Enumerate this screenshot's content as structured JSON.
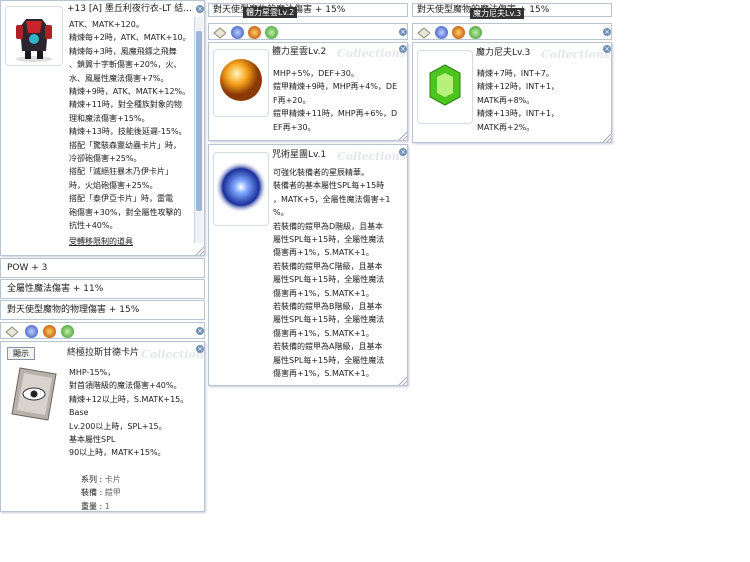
{
  "w1": {
    "title": "+13 [A] 墨丘利夜行衣-LT 結...",
    "watermark": "Collections",
    "lines": [
      "ATK、MATK+120。",
      "精煉每+2時，ATK、MATK+10。",
      "精煉每+3時，風魔飛鏢之飛舞",
      "、鎖翼十字斬傷害+20%，火、",
      "水、風屬性魔法傷害+7%。",
      "精煉+9時，ATK、MATK+12%。",
      "精煉+11時，對全種族對象的物",
      "理和魔法傷害+15%。",
      "精煉+13時，技能後延遲-15%。",
      "搭配「驚駭森靈幼蟲卡片」時，",
      "冷卻砲傷害+25%。",
      "搭配「滅絕狂暴木乃伊卡片」",
      "時，火焰砲傷害+25%。",
      "搭配「泰伊亞卡片」時，雷電",
      "砲傷害+30%，對全屬性攻擊的",
      "抗性+40%。"
    ],
    "link": "受轉移限制的道具"
  },
  "bars": {
    "pow": "POW + 3",
    "magic": "全屬性魔法傷害 + 11%",
    "phys": "對天使型魔物的物理傷害 + 15%"
  },
  "w2": {
    "title": "終極拉斯甘德卡片",
    "btn": "顯示",
    "watermark": "Collections",
    "lines": [
      "MHP-15%，",
      "對首領階級的魔法傷害+40%。",
      "精煉+12以上時，S.MATK+15。",
      "Base",
      "Lv.200以上時，SPL+15。",
      "基本屬性SPL",
      "90以上時，MATK+15%。"
    ],
    "attrs": [
      {
        "k": "系列",
        "v": "卡片"
      },
      {
        "k": "裝備",
        "v": "鎧甲"
      },
      {
        "k": "重量",
        "v": "1"
      }
    ]
  },
  "mid": {
    "bar": "對天使型魔物的魔法傷害 + 15%",
    "tip": "體力星雲Lv.2",
    "w3": {
      "title": "體力星雲Lv.2",
      "watermark": "Collections",
      "lines": [
        "MHP+5%，DEF+30。",
        "鎧甲精煉+9時，MHP再+4%，DE",
        "F再+20。",
        "鎧甲精煉+11時，MHP再+6%，D",
        "EF再+30。"
      ]
    },
    "w4": {
      "title": "咒術星團Lv.1",
      "watermark": "Collections",
      "lines": [
        "可強化裝備者的星辰精華。",
        "裝備者的基本屬性SPL每+15時",
        "，MATK+5，全屬性魔法傷害+1",
        "%。",
        "若裝備的鎧甲為D階級，且基本",
        "屬性SPL每+15時，全屬性魔法",
        "傷害再+1%，S.MATK+1。",
        "若裝備的鎧甲為C階級，且基本",
        "屬性SPL每+15時，全屬性魔法",
        "傷害再+1%，S.MATK+1。",
        "若裝備的鎧甲為B階級，且基本",
        "屬性SPL每+15時，全屬性魔法",
        "傷害再+1%，S.MATK+1。",
        "若裝備的鎧甲為A階級，且基本",
        "屬性SPL每+15時，全屬性魔法",
        "傷害再+1%，S.MATK+1。"
      ]
    }
  },
  "right": {
    "bar": "對天使型魔物的魔法傷害 + 15%",
    "tip": "魔力尼夫Lv.3",
    "w5": {
      "title": "魔力尼夫Lv.3",
      "watermark": "Collections",
      "lines": [
        "精煉+7時，INT+7。",
        "精煉+12時，INT+1，",
        "MATK再+8%。",
        "精煉+13時，INT+1，",
        "MATK再+2%。"
      ]
    }
  },
  "colors": {
    "border": "#b8c4d0",
    "scroll": "#9db6d4",
    "close": "#6f8fb5"
  }
}
